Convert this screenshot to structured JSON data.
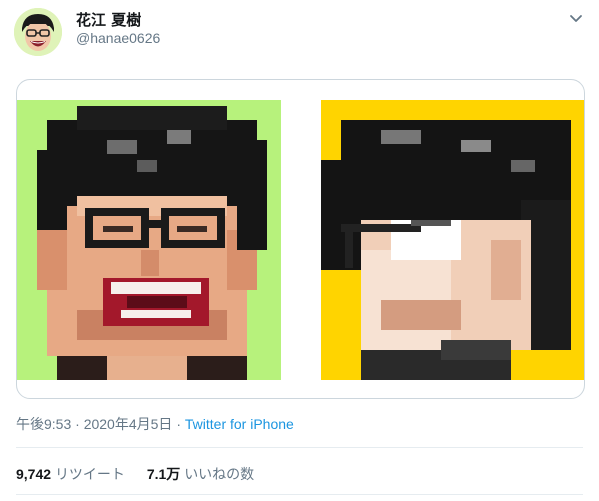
{
  "tweet": {
    "author_name": "花江 夏樹",
    "author_handle": "@hanae0626",
    "time": "午後9:53",
    "sep": "·",
    "date": "2020年4月5日",
    "source": "Twitter for iPhone"
  },
  "stats": {
    "retweets_count": "9,742",
    "retweets_label": "リツイート",
    "likes_count": "7.1万",
    "likes_label": "いいねの数"
  },
  "media": {
    "images": [
      {
        "bg": "#b7f27c",
        "description_icon": "pixel-art-portrait-laughing"
      },
      {
        "bg": "#ffd400",
        "description_icon": "pixel-art-portrait-profile"
      }
    ]
  },
  "colors": {
    "link": "#1b95e0",
    "secondary_text": "#657786",
    "border": "#ccd6dd"
  }
}
